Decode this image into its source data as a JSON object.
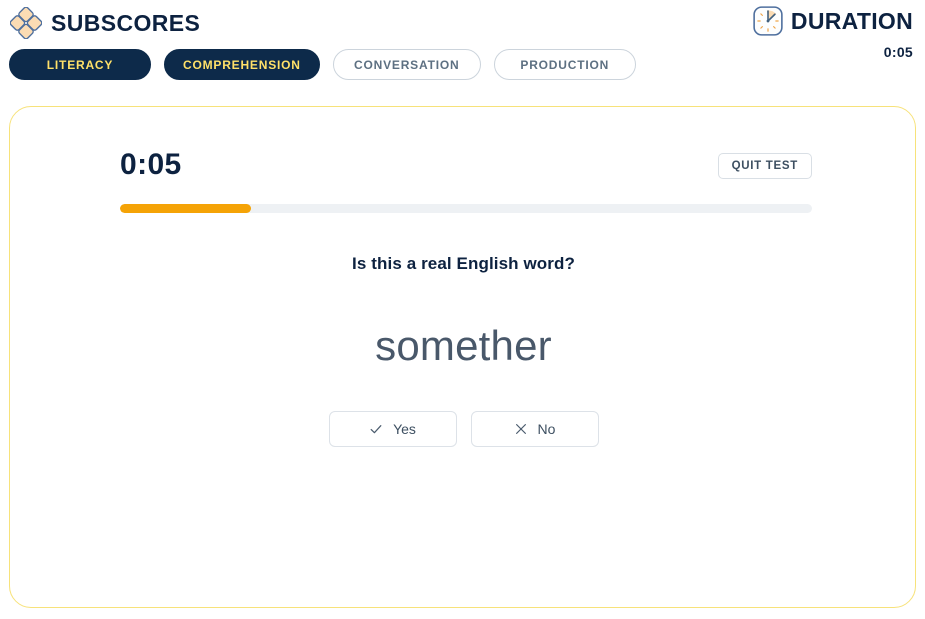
{
  "header": {
    "brand_title": "SUBSCORES",
    "brand_icon": "diamond-lattice-logo",
    "duration_label": "DURATION",
    "duration_value": "0:05",
    "duration_icon": "stopwatch-icon"
  },
  "tabs": [
    {
      "label": "LITERACY",
      "state": "active"
    },
    {
      "label": "COMPREHENSION",
      "state": "active"
    },
    {
      "label": "CONVERSATION",
      "state": "inactive"
    },
    {
      "label": "PRODUCTION",
      "state": "inactive"
    }
  ],
  "card": {
    "timer": "0:05",
    "quit_label": "QUIT TEST",
    "progress_percent": 19,
    "question": "Is this a real English word?",
    "prompt_word": "somether",
    "answers": [
      {
        "label": "Yes",
        "icon": "check-icon"
      },
      {
        "label": "No",
        "icon": "cross-icon"
      }
    ]
  },
  "colors": {
    "navy": "#0d2240",
    "tab_active_bg": "#0d2a4a",
    "tab_active_text": "#ffe169",
    "tab_inactive_text": "#5d7082",
    "tab_inactive_border": "#ccd4dc",
    "card_border": "#f7e27a",
    "progress_fill": "#f5a306",
    "progress_track": "#eef1f4",
    "word_text": "#49586a",
    "logo_fill": "#fbdcb4",
    "logo_stroke": "#4e6f9e"
  }
}
